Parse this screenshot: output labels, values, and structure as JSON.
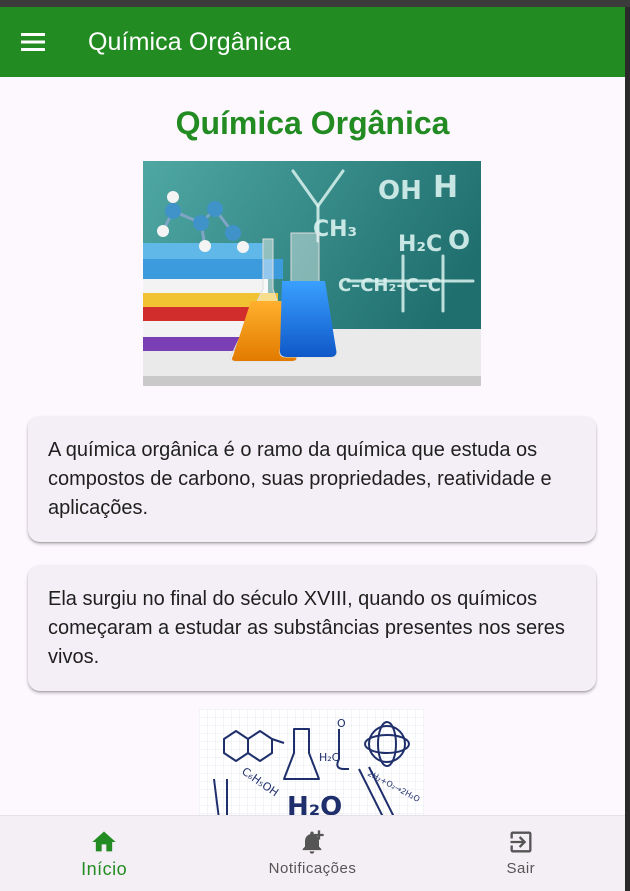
{
  "appbar": {
    "title": "Química Orgânica",
    "menu_icon": "menu-icon"
  },
  "page": {
    "heading": "Química Orgânica"
  },
  "cards": [
    {
      "text": "A química orgânica é o ramo da química que estuda os compostos de carbono, suas propriedades, reatividade e aplicações."
    },
    {
      "text": "Ela surgiu no final do século XVIII, quando os químicos começaram a estudar as substâncias presentes nos seres vivos."
    }
  ],
  "images": {
    "hero": {
      "formulas": [
        "OH",
        "H",
        "CH₃",
        "H₂C",
        "O",
        "C–CH₂–C–C"
      ]
    },
    "sketch": {
      "formulas": [
        "H₂C",
        "O",
        "C₆H₅OH",
        "H₂O",
        "2H₂+O₂→2H₂O"
      ]
    }
  },
  "bottom_nav": {
    "items": [
      {
        "label": "Início",
        "icon": "home-icon",
        "active": true
      },
      {
        "label": "Notificações",
        "icon": "notification-add-icon",
        "active": false
      },
      {
        "label": "Sair",
        "icon": "logout-icon",
        "active": false
      }
    ]
  },
  "colors": {
    "primary": "#228b22",
    "background": "#fdf7fe",
    "card": "#f4eff6",
    "nav": "#f4eff5"
  }
}
